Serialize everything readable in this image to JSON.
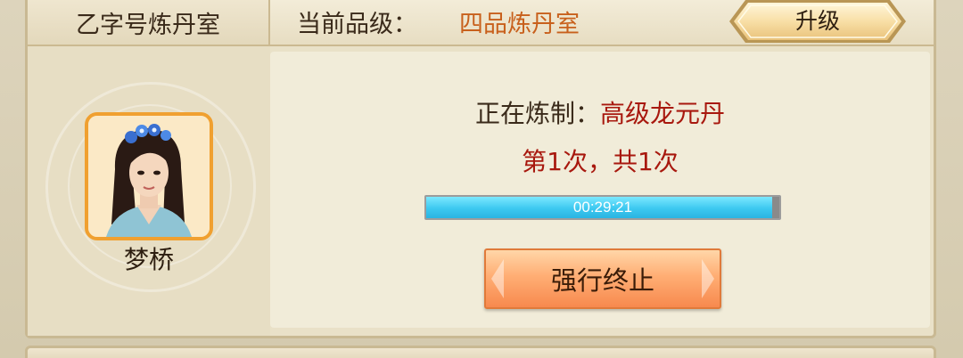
{
  "room": {
    "name": "乙字号炼丹室"
  },
  "grade": {
    "label": "当前品级：",
    "value": "四品炼丹室"
  },
  "upgrade_button": {
    "label": "升级"
  },
  "alchemist": {
    "name": "梦桥"
  },
  "refining": {
    "label": "正在炼制：",
    "pill_name": "高级龙元丹",
    "count_text": "第1次，共1次"
  },
  "progress": {
    "time_remaining": "00:29:21",
    "fill_fraction": 0.98
  },
  "stop_button": {
    "label": "强行终止"
  },
  "colors": {
    "accent_orange": "#c8601c",
    "highlight_red": "#a8180e",
    "progress_blue": "#3cc8f0",
    "button_orange": "#f7894e"
  }
}
